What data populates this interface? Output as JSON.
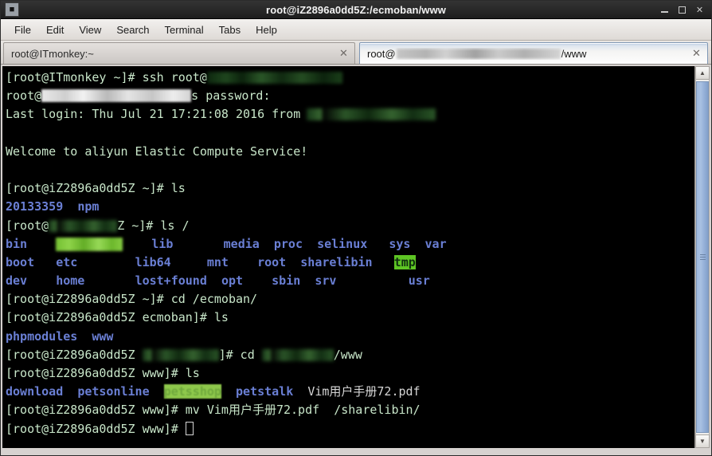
{
  "window": {
    "title": "root@iZ2896a0dd5Z:/ecmoban/www",
    "icon": "terminal-icon",
    "buttons": {
      "minimize": "minimize",
      "maximize": "maximize",
      "close": "close"
    }
  },
  "menu": {
    "items": [
      "File",
      "Edit",
      "View",
      "Search",
      "Terminal",
      "Tabs",
      "Help"
    ]
  },
  "tabs": [
    {
      "label": "root@ITmonkey:~",
      "active": false,
      "close": "close-tab"
    },
    {
      "label_prefix": "root@",
      "label_suffix": "/www",
      "redacted": true,
      "active": true,
      "close": "close-tab"
    }
  ],
  "terminal": {
    "colors": {
      "background": "#000000",
      "prompt_text": "#c8e6c9",
      "default_text": "#d6d6d6",
      "directory_blue": "#6a7fd4",
      "sticky_dir_bg": "#5ec524",
      "highlight_green_bg": "#8ec84b"
    },
    "lines": [
      {
        "id": "l01",
        "type": "prompt",
        "text": "[root@ITmonkey ~]# ssh root@",
        "redacted_after": true
      },
      {
        "id": "l02",
        "type": "output",
        "text_prefix": "root@",
        "redacted_mid": true,
        "text_suffix": "s password:"
      },
      {
        "id": "l03",
        "type": "output",
        "text": "Last login: Thu Jul 21 17:21:08 2016 from",
        "redacted_after": true
      },
      {
        "id": "l04",
        "type": "blank",
        "text": ""
      },
      {
        "id": "l05",
        "type": "output",
        "text": "Welcome to aliyun Elastic Compute Service!"
      },
      {
        "id": "l06",
        "type": "blank",
        "text": ""
      },
      {
        "id": "l07",
        "type": "prompt",
        "text": "[root@iZ2896a0dd5Z ~]# ls"
      },
      {
        "id": "l08",
        "type": "listing",
        "items": [
          "20133359",
          "npm"
        ]
      },
      {
        "id": "l09",
        "type": "prompt",
        "text_prefix": "[root@",
        "redacted_mid": true,
        "text_suffix": "Z ~]# ls /"
      },
      {
        "id": "l10",
        "type": "ls-root-row",
        "cells": [
          "bin",
          "__REDACTED_HL__",
          "lib",
          "media",
          "proc",
          "selinux",
          "sys",
          "var"
        ]
      },
      {
        "id": "l11",
        "type": "ls-root-row",
        "cells": [
          "boot",
          "etc",
          "lib64",
          "mnt",
          "root",
          "sharelibin",
          "tmp",
          ""
        ]
      },
      {
        "id": "l12",
        "type": "ls-root-row",
        "cells": [
          "dev",
          "home",
          "lost+found",
          "opt",
          "sbin",
          "srv",
          "usr",
          ""
        ]
      },
      {
        "id": "l13",
        "type": "prompt",
        "text": "[root@iZ2896a0dd5Z ~]# cd /ecmoban/"
      },
      {
        "id": "l14",
        "type": "prompt",
        "text": "[root@iZ2896a0dd5Z ecmoban]# ls"
      },
      {
        "id": "l15",
        "type": "listing",
        "items": [
          "phpmodules",
          "www"
        ]
      },
      {
        "id": "l16",
        "type": "prompt",
        "text_prefix": "[root@iZ2896a0dd5Z ",
        "redacted_mid": true,
        "text_mid": "]# cd ",
        "redacted_mid2": true,
        "text_suffix": "/www"
      },
      {
        "id": "l17",
        "type": "prompt",
        "text": "[root@iZ2896a0dd5Z www]# ls"
      },
      {
        "id": "l18",
        "type": "listing-www",
        "items": [
          "download",
          "petsonline",
          "petsshop",
          "petstalk",
          "Vim用户手册72.pdf"
        ]
      },
      {
        "id": "l19",
        "type": "prompt",
        "text": "[root@iZ2896a0dd5Z www]# mv Vim用户手册72.pdf  /sharelibin/"
      },
      {
        "id": "l20",
        "type": "prompt-cursor",
        "text": "[root@iZ2896a0dd5Z www]# "
      }
    ],
    "ls_root": {
      "col_bin": "bin",
      "col_boot": "boot",
      "col_dev": "dev",
      "col_redacted": "",
      "col_etc": "etc",
      "col_home": "home",
      "col_lib": "lib",
      "col_lib64": "lib64",
      "col_lostfound": "lost+found",
      "col_media": "media",
      "col_mnt": "mnt",
      "col_opt": "opt",
      "col_proc": "proc",
      "col_root": "root",
      "col_sbin": "sbin",
      "col_selinux": "selinux",
      "col_sharelibin": "sharelibin",
      "col_srv": "srv",
      "col_sys": "sys",
      "col_tmp": "tmp",
      "col_usr": "usr",
      "col_var": "var"
    },
    "home_listing": {
      "dir1": "20133359",
      "dir2": "npm"
    },
    "ecmoban_listing": {
      "dir1": "phpmodules",
      "dir2": "www"
    },
    "www_listing": {
      "d1": "download",
      "d2": "petsonline",
      "d3": "petsshop",
      "d4": "petstalk",
      "f1": "Vim用户手册72.pdf"
    },
    "prompt_l01": "[root@ITmonkey ~]# ssh root@",
    "prompt_l02_prefix": "root@",
    "prompt_l02_suffix": "s password:",
    "line_l03": "Last login: Thu Jul 21 17:21:08 2016 from",
    "line_l05": "Welcome to aliyun Elastic Compute Service!",
    "prompt_l07": "[root@iZ2896a0dd5Z ~]# ls",
    "prompt_l09_prefix": "[root@",
    "prompt_l09_suffix": "Z ~]# ls /",
    "prompt_l13": "[root@iZ2896a0dd5Z ~]# cd /ecmoban/",
    "prompt_l14": "[root@iZ2896a0dd5Z ecmoban]# ls",
    "prompt_l16_prefix": "[root@iZ2896a0dd5Z ",
    "prompt_l16_mid": "]# cd ",
    "prompt_l16_suffix": "/www",
    "prompt_l17": "[root@iZ2896a0dd5Z www]# ls",
    "prompt_l19": "[root@iZ2896a0dd5Z www]# mv Vim用户手册72.pdf  /sharelibin/",
    "prompt_l20": "[root@iZ2896a0dd5Z www]# "
  },
  "scrollbar": {
    "up_arrow": "▲",
    "down_arrow": "▼"
  }
}
